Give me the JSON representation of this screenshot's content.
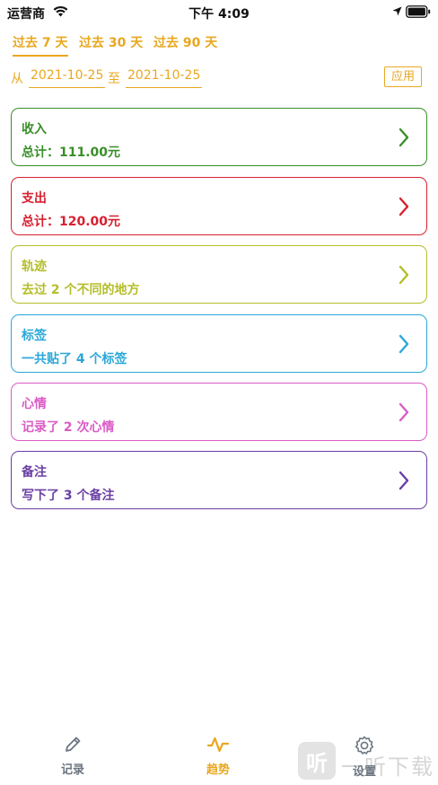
{
  "status_bar": {
    "carrier": "运营商",
    "time": "下午 4:09"
  },
  "range_tabs": [
    {
      "label": "过去 7 天",
      "active": true
    },
    {
      "label": "过去 30 天",
      "active": false
    },
    {
      "label": "过去 90 天",
      "active": false
    }
  ],
  "date_range": {
    "from_label": "从",
    "from_value": "2021-10-25",
    "to_label": "至",
    "to_value": "2021-10-25",
    "apply_label": "应用"
  },
  "cards": [
    {
      "title": "收入",
      "subtitle": "总计：111.00元",
      "color": "#3A8F2A"
    },
    {
      "title": "支出",
      "subtitle": "总计：120.00元",
      "color": "#D8202F"
    },
    {
      "title": "轨迹",
      "subtitle": "去过 2 个不同的地方",
      "color": "#B4BE2A"
    },
    {
      "title": "标签",
      "subtitle": "一共贴了 4 个标签",
      "color": "#2AA7D9"
    },
    {
      "title": "心情",
      "subtitle": "记录了 2 次心情",
      "color": "#DA5CC5"
    },
    {
      "title": "备注",
      "subtitle": "写下了 3 个备注",
      "color": "#6A3FA3"
    }
  ],
  "tab_bar": {
    "items": [
      {
        "label": "记录",
        "icon": "pencil-icon",
        "active": false
      },
      {
        "label": "趋势",
        "icon": "trend-icon",
        "active": true
      },
      {
        "label": "设置",
        "icon": "gear-icon",
        "active": false
      }
    ],
    "active_color": "#E9A71F",
    "inactive_color": "#6B7480"
  },
  "watermark": {
    "glyph": "听",
    "text": "一听下载"
  }
}
